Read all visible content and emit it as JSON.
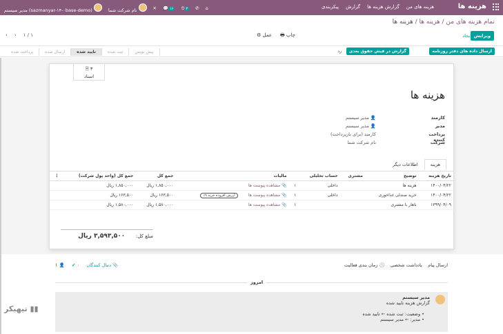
{
  "navbar": {
    "brand": "هزینه ها",
    "menu": [
      "هزینه های من",
      "گزارش هزینه ها",
      "گزارش",
      "پیکربندی"
    ],
    "company": "نام شرکت شما",
    "user": "مدیر سیستم (sazmanyar-۱۴-۰base-demo)",
    "badge1": "۱۶",
    "badge2": "۳"
  },
  "breadcrumb": {
    "part1": "تمام هزینه های من",
    "part2": "هزینه ها",
    "current": "هزینه ها"
  },
  "buttons": {
    "edit": "ویرایش",
    "create": "ایجاد",
    "print": "چاپ",
    "action": "عمل",
    "post": "ارسال داده های دفتر روزنامه",
    "report": "گزارش در فیش حقوق بعدی",
    "refuse": "رد"
  },
  "pager": {
    "value": "۱ / ۱"
  },
  "stages": [
    "پیش نویس",
    "ثبت شده",
    "تایید شده",
    "ارسال شده",
    "پرداخت شده"
  ],
  "active_stage": "تایید شده",
  "doc_button": {
    "count": "۳",
    "label": "اسناد"
  },
  "form": {
    "title": "هزینه ها",
    "employee_label": "کارمند",
    "employee": "مدیر سیستم",
    "manager_label": "مدیر",
    "manager": "مدیر سیستم",
    "paid_by_label": "پرداخت کننده",
    "paid_by": "کارمند (برای بازپرداخت)",
    "company_label": "شرکت",
    "company": "نام شرکت شما"
  },
  "tabs": [
    "هزینه",
    "اطلاعات دیگر"
  ],
  "table": {
    "headers": [
      "تاریخ هزینه",
      "توضیح",
      "مشتری",
      "حساب تحلیلی",
      "",
      "مالیات",
      "جمع کل",
      "جمع کل (واحد پول شرکت)"
    ],
    "rows": [
      {
        "date": "۱۴۰۰/۰۴/۲۲",
        "desc": "هزینه ها",
        "customer": "",
        "account": "داخلی",
        "count": "۱",
        "attach": "مشاهده پیوست ها",
        "tax": "",
        "total": "۱,۸۵۰,۰۰۰ ریال",
        "total_co": "۱,۸۵۰,۰۰۰ ریال"
      },
      {
        "date": "۱۴۰۰/۰۴/۲۲",
        "desc": "خرید صندلی غذاخوری",
        "customer": "",
        "account": "داخلی",
        "count": "۱",
        "attach": "مشاهده پیوست ها",
        "tax": "ارزش افزوده خرید ۹٪",
        "total": "۱۶۳,۵۰۰ ریال",
        "total_co": "۱۶۳,۵۰۰ ریال"
      },
      {
        "date": "۱۳۹۹/۰۴/۰۹",
        "desc": "ناهار با مشتری",
        "customer": "",
        "account": "",
        "count": "۱",
        "attach": "مشاهده پیوست ها",
        "tax": "",
        "total": "۱,۵۸۰,۰۰۰ ریال",
        "total_co": "۱,۵۸۰,۰۰۰ ریال"
      }
    ]
  },
  "total": {
    "label": "مبلغ کل:",
    "value": "۳,۵۹۳,۵۰۰ ریال"
  },
  "chatter": {
    "send": "ارسال پیام",
    "note": "یادداشت شخصی",
    "schedule": "زمان بندی فعالیت",
    "attachments": "۰",
    "follow": "دنبال کنندگان",
    "followers": "۱",
    "today": "امروز",
    "author": "مدیر سیستم",
    "message": "گزارش هزینه تایید شده",
    "change1": "وضعیت: ثبت شده ← تایید شده",
    "change2": "مدیر: ← مدیر سیستم"
  },
  "watermark": "تیهیکر"
}
